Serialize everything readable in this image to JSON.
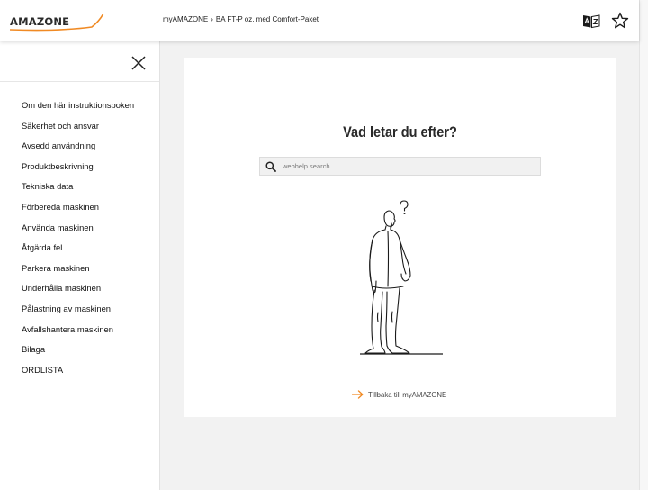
{
  "header": {
    "logo_text": "AMAZONE",
    "breadcrumb": {
      "root": "myAMAZONE",
      "separator": "›",
      "current": "BA FT-P oz. med Comfort-Paket"
    },
    "icons": [
      "dictionary-icon",
      "favorite-star-icon"
    ]
  },
  "sidebar": {
    "close_icon": "close-icon",
    "items": [
      {
        "label": "Om den här instruktionsboken"
      },
      {
        "label": "Säkerhet och ansvar"
      },
      {
        "label": "Avsedd användning"
      },
      {
        "label": "Produktbeskrivning"
      },
      {
        "label": "Tekniska data"
      },
      {
        "label": "Förbereda maskinen"
      },
      {
        "label": "Använda maskinen"
      },
      {
        "label": "Åtgärda fel"
      },
      {
        "label": "Parkera maskinen"
      },
      {
        "label": "Underhålla maskinen"
      },
      {
        "label": "Pålastning av maskinen"
      },
      {
        "label": "Avfallshantera maskinen"
      },
      {
        "label": "Bilaga"
      },
      {
        "label": "ORDLISTA"
      }
    ]
  },
  "main": {
    "title": "Vad letar du efter?",
    "search": {
      "placeholder": "webhelp.search",
      "value": ""
    },
    "back_link": "Tillbaka till myAMAZONE"
  },
  "colors": {
    "accent": "#f08a24",
    "background": "#f2f2f2",
    "text": "#1a1a1a"
  }
}
